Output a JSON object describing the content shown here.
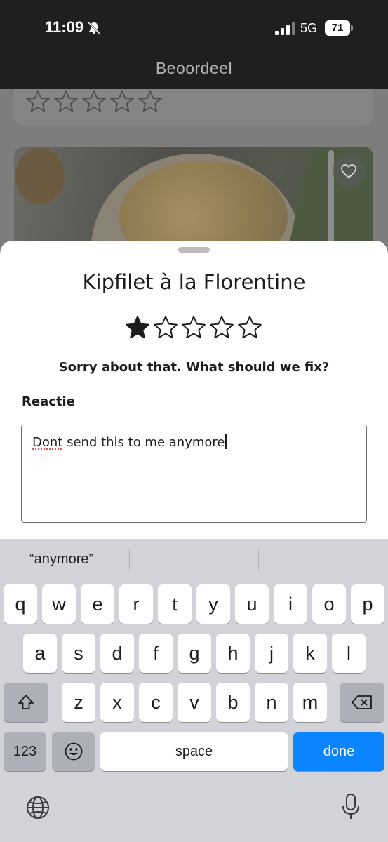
{
  "status_bar": {
    "time": "11:09",
    "network": "5G",
    "battery": "71"
  },
  "header": {
    "title": "Beoordeel"
  },
  "sheet": {
    "dish_title": "Kipfilet à la Florentine",
    "rating": {
      "value": 1,
      "max": 5
    },
    "prompt": "Sorry about that. What should we fix?",
    "field_label": "Reactie",
    "comment": {
      "misspelled": "Dont",
      "rest": " send this to me anymore"
    }
  },
  "keyboard": {
    "suggestions": [
      "“anymore”",
      "",
      ""
    ],
    "rows": [
      [
        "q",
        "w",
        "e",
        "r",
        "t",
        "y",
        "u",
        "i",
        "o",
        "p"
      ],
      [
        "a",
        "s",
        "d",
        "f",
        "g",
        "h",
        "j",
        "k",
        "l"
      ],
      [
        "z",
        "x",
        "c",
        "v",
        "b",
        "n",
        "m"
      ]
    ],
    "numbers_label": "123",
    "space_label": "space",
    "done_label": "done"
  },
  "colors": {
    "accent": "#0a84ff",
    "header_bg": "#1f1f1f",
    "keyboard_bg": "#d1d3d9"
  }
}
